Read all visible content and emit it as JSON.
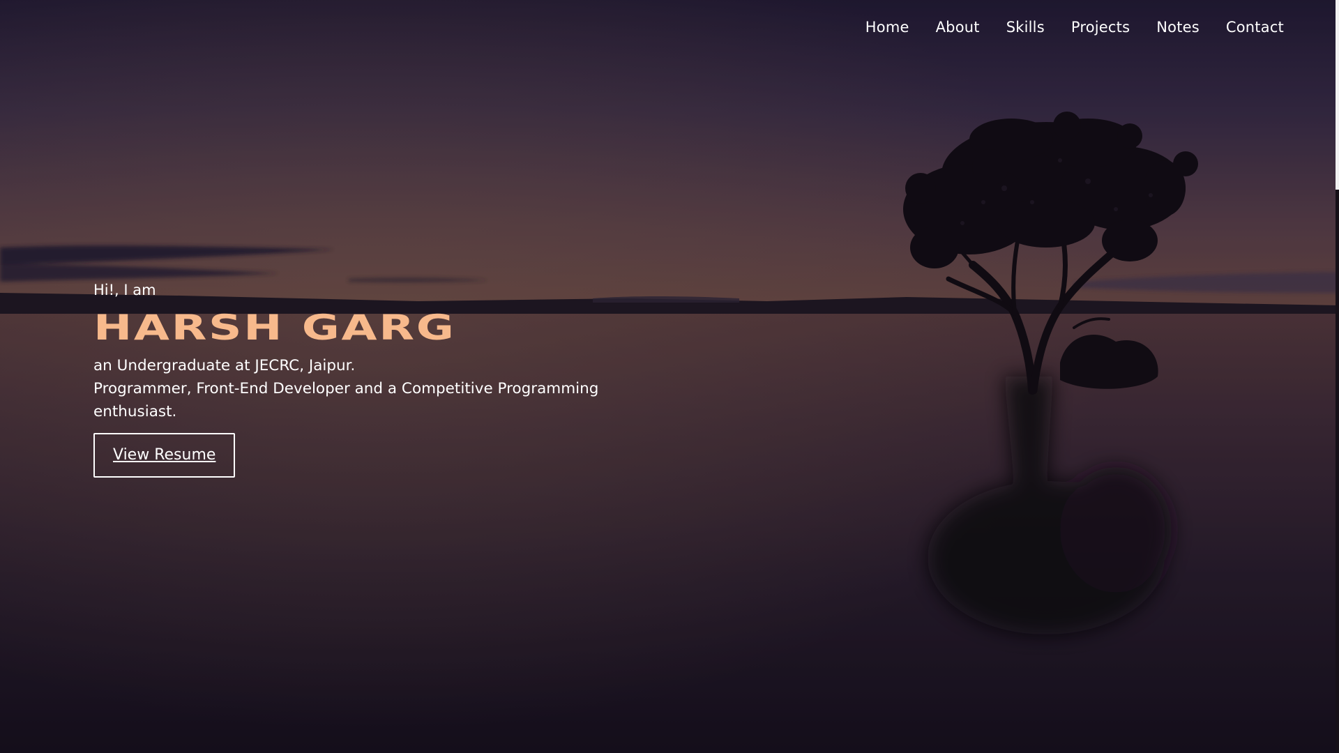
{
  "nav": {
    "items": [
      {
        "label": "Home"
      },
      {
        "label": "About"
      },
      {
        "label": "Skills"
      },
      {
        "label": "Projects"
      },
      {
        "label": "Notes"
      },
      {
        "label": "Contact"
      }
    ]
  },
  "hero": {
    "greeting": "Hi!, I am",
    "name": "HARSH GARG",
    "line1": "an Undergraduate at JECRC, Jaipur.",
    "line2": "Programmer, Front-End Developer and a Competitive Programming enthusiast.",
    "button_label": "View Resume"
  },
  "colors": {
    "name_accent": "#f7b98c",
    "text": "#ffffff"
  }
}
